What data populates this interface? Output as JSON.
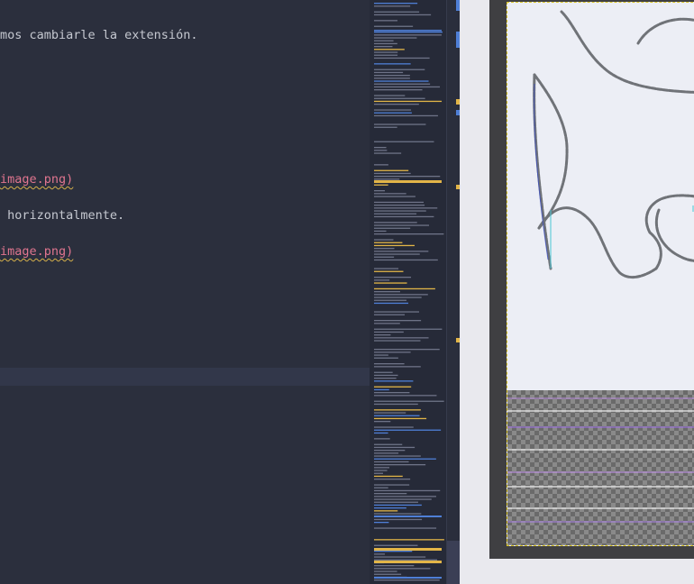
{
  "editor": {
    "lines": [
      {
        "id": "text1",
        "text": "mos cambiarle la extensión."
      },
      {
        "id": "link1",
        "text": "image.png)"
      },
      {
        "id": "text2",
        "text": " horizontalmente."
      },
      {
        "id": "link2",
        "text": "image.png)"
      }
    ]
  },
  "colors": {
    "editor_bg": "#2b2f3d",
    "text": "#c5c8d0",
    "link": "#e0758f",
    "spell_underline": "#d6b14a",
    "current_line": "#32374a",
    "minimap_blue": "#4f7fd6",
    "minimap_yellow": "#e2b548",
    "viewer_bg": "#e9e9ee",
    "canvas_border": "#d8c322"
  },
  "viewer": {
    "image_name": "image.png"
  }
}
